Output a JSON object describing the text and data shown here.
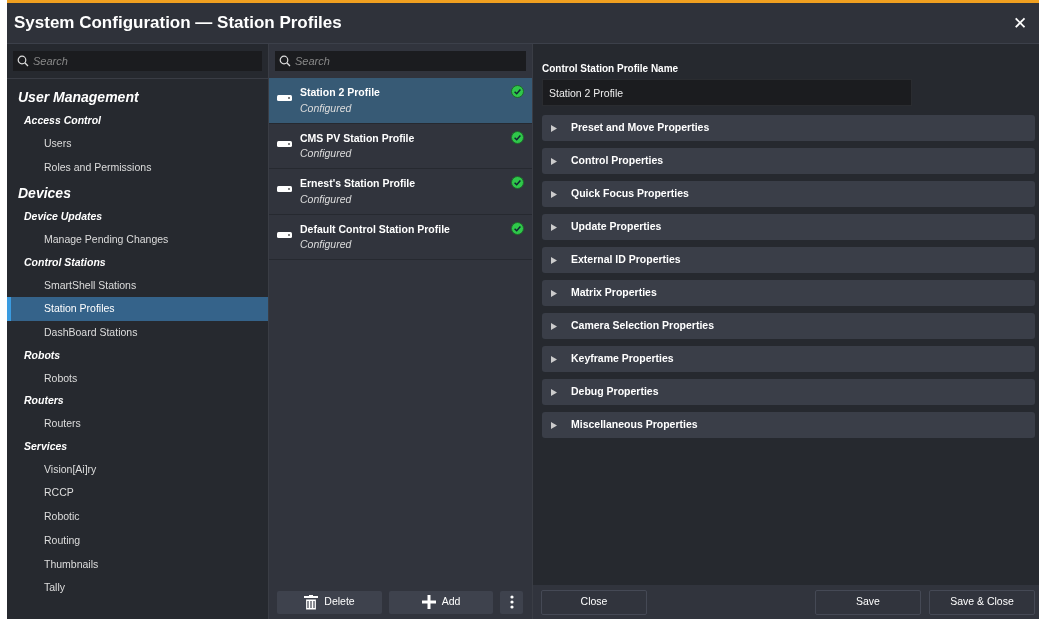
{
  "window": {
    "title": "System Configuration — Station Profiles",
    "close_label": "✕"
  },
  "sidebar": {
    "search": {
      "placeholder": "Search"
    },
    "sections": [
      {
        "label": "User Management",
        "children": [
          {
            "label": "Access Control",
            "children": [
              {
                "label": "Users",
                "selected": false
              },
              {
                "label": "Roles and Permissions",
                "selected": false
              }
            ]
          }
        ]
      },
      {
        "label": "Devices",
        "children": [
          {
            "label": "Device Updates",
            "children": [
              {
                "label": "Manage Pending Changes",
                "selected": false
              }
            ]
          },
          {
            "label": "Control Stations",
            "children": [
              {
                "label": "SmartShell Stations",
                "selected": false
              },
              {
                "label": "Station Profiles",
                "selected": true
              },
              {
                "label": "DashBoard Stations",
                "selected": false
              }
            ]
          },
          {
            "label": "Robots",
            "children": [
              {
                "label": "Robots",
                "selected": false
              }
            ]
          },
          {
            "label": "Routers",
            "children": [
              {
                "label": "Routers",
                "selected": false
              }
            ]
          },
          {
            "label": "Services",
            "children": [
              {
                "label": "Vision[Ai]ry",
                "selected": false
              },
              {
                "label": "RCCP",
                "selected": false
              },
              {
                "label": "Robotic",
                "selected": false
              },
              {
                "label": "Routing",
                "selected": false
              },
              {
                "label": "Thumbnails",
                "selected": false
              },
              {
                "label": "Tally",
                "selected": false
              }
            ]
          }
        ]
      }
    ]
  },
  "profiles": {
    "search": {
      "placeholder": "Search"
    },
    "items": [
      {
        "name": "Station 2 Profile",
        "status": "Configured",
        "configured": true,
        "selected": true
      },
      {
        "name": "CMS PV Station Profile",
        "status": "Configured",
        "configured": true,
        "selected": false
      },
      {
        "name": "Ernest's Station Profile",
        "status": "Configured",
        "configured": true,
        "selected": false
      },
      {
        "name": "Default Control Station Profile",
        "status": "Configured",
        "configured": true,
        "selected": false
      }
    ],
    "buttons": [
      {
        "kind": "delete",
        "label": "Delete"
      },
      {
        "kind": "add",
        "label": "Add"
      },
      {
        "kind": "more"
      }
    ]
  },
  "details": {
    "name_label": "Control Station Profile Name",
    "name_value": "Station 2 Profile",
    "sections": [
      {
        "label": "Preset and Move Properties",
        "expanded": false
      },
      {
        "label": "Control Properties",
        "expanded": false
      },
      {
        "label": "Quick Focus Properties",
        "expanded": false
      },
      {
        "label": "Update Properties",
        "expanded": false
      },
      {
        "label": "External ID Properties",
        "expanded": false
      },
      {
        "label": "Matrix Properties",
        "expanded": false
      },
      {
        "label": "Camera Selection Properties",
        "expanded": false
      },
      {
        "label": "Keyframe Properties",
        "expanded": false
      },
      {
        "label": "Debug Properties",
        "expanded": false
      },
      {
        "label": "Miscellaneous Properties",
        "expanded": false
      }
    ]
  },
  "footer": {
    "buttons": [
      {
        "label": "Close",
        "kind": "left"
      },
      {
        "label": "Save",
        "kind": "right"
      },
      {
        "label": "Save & Close",
        "kind": "right"
      }
    ]
  }
}
